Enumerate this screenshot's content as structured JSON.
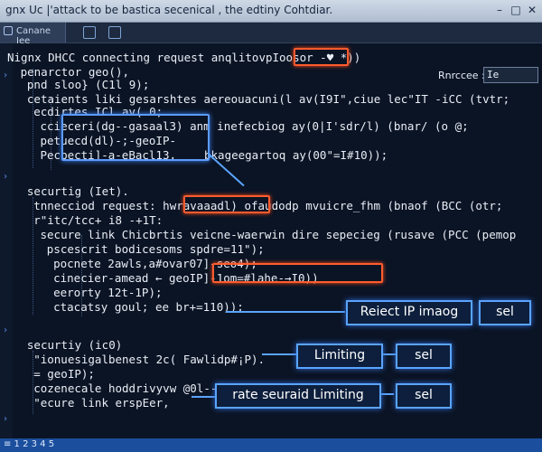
{
  "window": {
    "title": "gnx Uc |'attack to be bastica secenical , the edtiny Cohtdiar.",
    "minimize": "–",
    "maximize": "□",
    "close": "✕"
  },
  "toolbar": {
    "tab_label": "Canane Iee",
    "icons": [
      "grid-icon",
      "panel-icon"
    ]
  },
  "side_panel": {
    "label": "Rnrccee :",
    "field_value": "Ie"
  },
  "code": [
    {
      "text": "Nignx DHCC connecting request anqlitovpIoosor -♥ *))",
      "indent": 0
    },
    {
      "text": "penarctor geo(),",
      "indent": 2
    },
    {
      "text": "pnd sloo} (C1l 9);",
      "indent": 3
    },
    {
      "text": "cetaients liki gesarshtes aereouacuni(l av(I9I\",ciue lec\"IT -iCC (tvtr;",
      "indent": 3
    },
    {
      "text": "ecdirtes ICl av( 0;",
      "indent": 4
    },
    {
      "text": "ccieceri(dg--gasaal3) anm inefecbiog ay(0|I'sdr/l) (bnar/ (o @;",
      "indent": 5
    },
    {
      "text": "petuecd(dl)-;-geoIP-",
      "indent": 5
    },
    {
      "text": "Pecbecti]-a-eBacl13,",
      "indent": 5
    },
    {
      "text": "bkageegartoq ay(00\"=I#10));",
      "indent": 25
    },
    {
      "text": "securtig (Iet).",
      "indent": 3
    },
    {
      "text": "tnnecciod request: hwravaaadl) ofaudodp mvuicre_fhm (bnaof (BCC (otr;",
      "indent": 4
    },
    {
      "text": "r\"itc/tcc+ i8 -+1T:",
      "indent": 4
    },
    {
      "text": "secure link Chicbrtis veicne-waerwin dire sepecieg (rusave (PCC (pemop",
      "indent": 5
    },
    {
      "text": "pscescrit bodicesoms spdre=11\");",
      "indent": 6
    },
    {
      "text": "pocnete 2awls,a#ovar07]-seo4);",
      "indent": 7
    },
    {
      "text": "cinecier-amead ← geoIP]-1om=#lahe-→I0))",
      "indent": 7
    },
    {
      "text": "eerorty 12t-1P);",
      "indent": 7
    },
    {
      "text": "ctacatsy goul; ee br+=110));",
      "indent": 7
    },
    {
      "text": "securtiy (ic0)",
      "indent": 3
    },
    {
      "text": "\"ionuesigalbenest 2c( Fawlidp#¡P).",
      "indent": 4
    },
    {
      "text": "= geoIP);",
      "indent": 4
    },
    {
      "text": "cozenecale hoddrivyvw @0l--a-*13;",
      "indent": 4
    },
    {
      "text": "\"ecure link erspEer,",
      "indent": 4
    }
  ],
  "tokens": {
    "highlight_red_1": "pcaaor -♥",
    "highlight_red_2": "hwravaaadl)",
    "highlight_red_3": "geoIP]-1om=#lahe-→I0))"
  },
  "actions": [
    {
      "label": "Reiect IP imaog"
    },
    {
      "label": "sel"
    },
    {
      "label": "Limiting"
    },
    {
      "label": "sel"
    },
    {
      "label": "rate seuraid Limiting"
    },
    {
      "label": "sel"
    }
  ],
  "statusbar": {
    "left": "≡ 1 2 3 4 5"
  }
}
